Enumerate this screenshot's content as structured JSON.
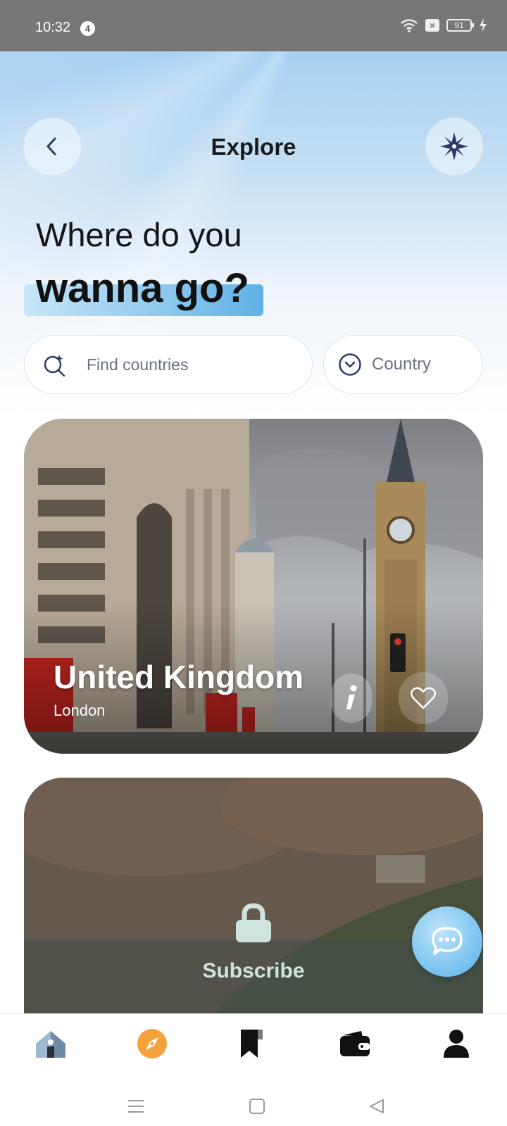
{
  "status_bar": {
    "time": "10:32",
    "notification_count": "4",
    "battery": "91"
  },
  "header": {
    "title": "Explore"
  },
  "headline": {
    "line1": "Where do you",
    "line2": "wanna go?"
  },
  "search": {
    "placeholder": "Find countries"
  },
  "country_filter": {
    "label": "Country"
  },
  "cards": [
    {
      "country": "United Kingdom",
      "city": "London"
    },
    {
      "locked_label": "Subscribe"
    }
  ],
  "colors": {
    "accent_orange": "#f5a23a",
    "accent_blue": "#6ab8ea",
    "icon_navy": "#2f3a6b"
  },
  "icons": {
    "back": "chevron-left-icon",
    "compass": "compass-star-icon",
    "search": "search-sparkle-icon",
    "dropdown": "chevron-down-circle-icon",
    "info": "info-icon",
    "favorite": "heart-icon",
    "lock": "lock-icon",
    "chat": "chat-bubble-icon",
    "nav": [
      "home-icon",
      "explore-compass-icon",
      "bookmark-icon",
      "wallet-icon",
      "profile-icon"
    ]
  }
}
